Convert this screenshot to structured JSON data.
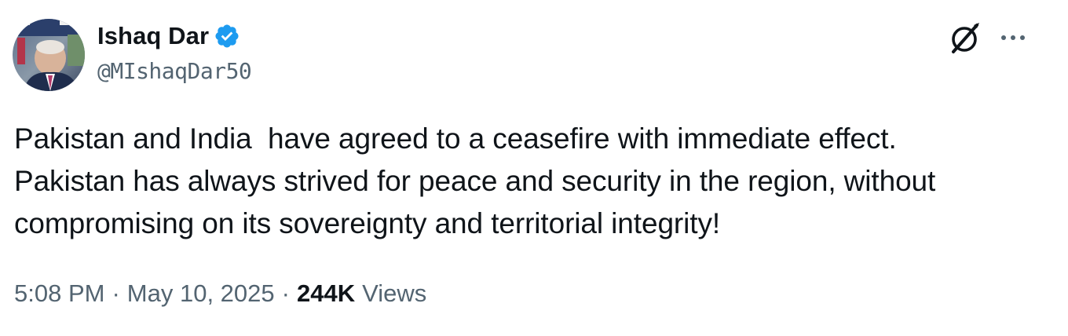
{
  "author": {
    "display_name": "Ishaq Dar",
    "handle": "@MIshaqDar50",
    "verified": true,
    "verified_color": "#1d9bf0"
  },
  "actions": {
    "grok_icon": "grok-icon",
    "more_icon": "more-options-icon"
  },
  "tweet": {
    "text": "Pakistan and India  have agreed to a ceasefire with immediate effect.\nPakistan has always strived for peace and security in the region, without\ncompromising on its sovereignty and territorial integrity!"
  },
  "meta": {
    "time": "5:08 PM",
    "separator": "·",
    "date": "May 10, 2025",
    "views_count": "244K",
    "views_label": "Views"
  },
  "colors": {
    "primary_text": "#0f1419",
    "secondary_text": "#536471",
    "background": "#ffffff"
  }
}
